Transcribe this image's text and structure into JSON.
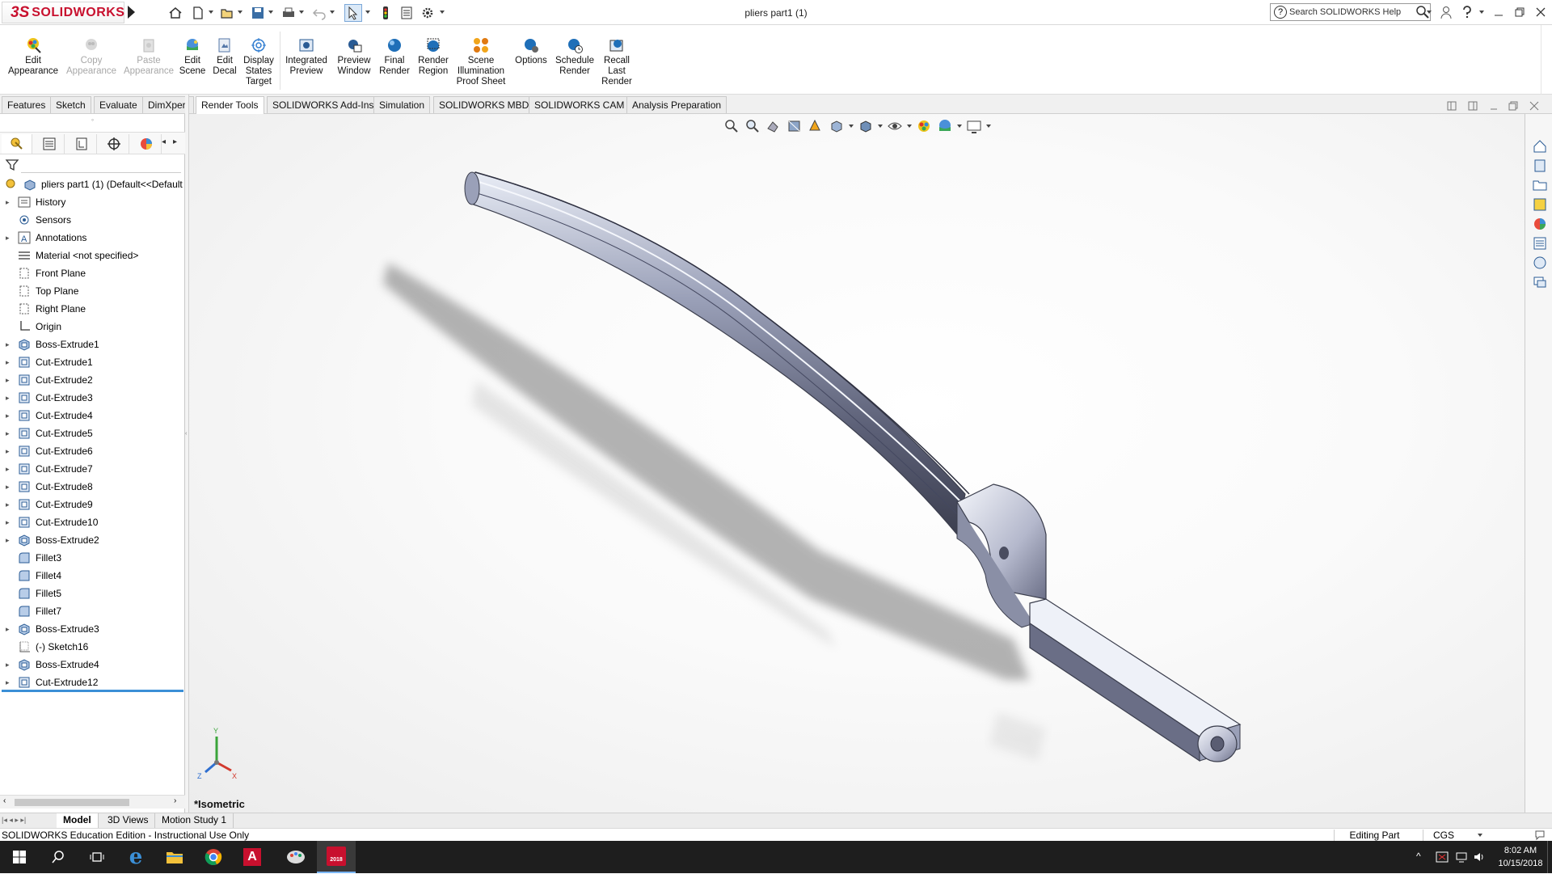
{
  "app": {
    "brand_ds": "3S",
    "brand_name": "SOLIDWORKS",
    "document_title": "pliers part1 (1)",
    "search_placeholder": "Search SOLIDWORKS Help",
    "search_q": "?",
    "brand_color": "#c8102e"
  },
  "command_manager": [
    {
      "label": "Edit Appearance",
      "icon": "edit-appearance-icon",
      "enabled": true
    },
    {
      "label": "Copy Appearance",
      "icon": "copy-appearance-icon",
      "enabled": false
    },
    {
      "label": "Paste Appearance",
      "icon": "paste-appearance-icon",
      "enabled": false
    },
    {
      "label": "Edit Scene",
      "icon": "edit-scene-icon",
      "enabled": true
    },
    {
      "label": "Edit Decal",
      "icon": "edit-decal-icon",
      "enabled": true
    },
    {
      "label": "Display States Target",
      "icon": "display-states-target-icon",
      "enabled": true
    },
    {
      "label": "Integrated Preview",
      "icon": "integrated-preview-icon",
      "enabled": true
    },
    {
      "label": "Preview Window",
      "icon": "preview-window-icon",
      "enabled": true
    },
    {
      "label": "Final Render",
      "icon": "final-render-icon",
      "enabled": true
    },
    {
      "label": "Render Region",
      "icon": "render-region-icon",
      "enabled": true
    },
    {
      "label": "Scene Illumination Proof Sheet",
      "icon": "scene-illumination-icon",
      "enabled": true
    },
    {
      "label": "Options",
      "icon": "options-icon",
      "enabled": true
    },
    {
      "label": "Schedule Render",
      "icon": "schedule-render-icon",
      "enabled": true
    },
    {
      "label": "Recall Last Render",
      "icon": "recall-last-render-icon",
      "enabled": true
    }
  ],
  "tabs": [
    "Features",
    "Sketch",
    "Evaluate",
    "DimXpert",
    "Render Tools",
    "SOLIDWORKS Add-Ins",
    "Simulation",
    "SOLIDWORKS MBD",
    "SOLIDWORKS CAM",
    "Analysis Preparation"
  ],
  "active_tab": "Render Tools",
  "tree": {
    "root": "pliers part1 (1)  (Default<<Default",
    "items": [
      {
        "label": "History",
        "expandable": true,
        "icon": "history-icon"
      },
      {
        "label": "Sensors",
        "expandable": false,
        "icon": "sensors-icon"
      },
      {
        "label": "Annotations",
        "expandable": true,
        "icon": "annotations-icon"
      },
      {
        "label": "Material <not specified>",
        "expandable": false,
        "icon": "material-icon"
      },
      {
        "label": "Front Plane",
        "expandable": false,
        "icon": "plane-icon"
      },
      {
        "label": "Top Plane",
        "expandable": false,
        "icon": "plane-icon"
      },
      {
        "label": "Right Plane",
        "expandable": false,
        "icon": "plane-icon"
      },
      {
        "label": "Origin",
        "expandable": false,
        "icon": "origin-icon"
      },
      {
        "label": "Boss-Extrude1",
        "expandable": true,
        "icon": "boss-extrude-icon"
      },
      {
        "label": "Cut-Extrude1",
        "expandable": true,
        "icon": "cut-extrude-icon"
      },
      {
        "label": "Cut-Extrude2",
        "expandable": true,
        "icon": "cut-extrude-icon"
      },
      {
        "label": "Cut-Extrude3",
        "expandable": true,
        "icon": "cut-extrude-icon"
      },
      {
        "label": "Cut-Extrude4",
        "expandable": true,
        "icon": "cut-extrude-icon"
      },
      {
        "label": "Cut-Extrude5",
        "expandable": true,
        "icon": "cut-extrude-icon"
      },
      {
        "label": "Cut-Extrude6",
        "expandable": true,
        "icon": "cut-extrude-icon"
      },
      {
        "label": "Cut-Extrude7",
        "expandable": true,
        "icon": "cut-extrude-icon"
      },
      {
        "label": "Cut-Extrude8",
        "expandable": true,
        "icon": "cut-extrude-icon"
      },
      {
        "label": "Cut-Extrude9",
        "expandable": true,
        "icon": "cut-extrude-icon"
      },
      {
        "label": "Cut-Extrude10",
        "expandable": true,
        "icon": "cut-extrude-icon"
      },
      {
        "label": "Boss-Extrude2",
        "expandable": true,
        "icon": "boss-extrude-icon"
      },
      {
        "label": "Fillet3",
        "expandable": false,
        "icon": "fillet-icon"
      },
      {
        "label": "Fillet4",
        "expandable": false,
        "icon": "fillet-icon"
      },
      {
        "label": "Fillet5",
        "expandable": false,
        "icon": "fillet-icon"
      },
      {
        "label": "Fillet7",
        "expandable": false,
        "icon": "fillet-icon"
      },
      {
        "label": "Boss-Extrude3",
        "expandable": true,
        "icon": "boss-extrude-icon"
      },
      {
        "label": "(-) Sketch16",
        "expandable": false,
        "icon": "sketch-icon"
      },
      {
        "label": "Boss-Extrude4",
        "expandable": true,
        "icon": "boss-extrude-icon"
      },
      {
        "label": "Cut-Extrude12",
        "expandable": true,
        "icon": "cut-extrude-icon"
      }
    ]
  },
  "viewport": {
    "view_label": "*Isometric",
    "triad": {
      "x": "X",
      "y": "Y",
      "z": "Z"
    }
  },
  "bottom_tabs": [
    "Model",
    "3D Views",
    "Motion Study 1"
  ],
  "active_bottom_tab": "Model",
  "status": {
    "left": "SOLIDWORKS Education Edition - Instructional Use Only",
    "mode": "Editing Part",
    "units": "CGS"
  },
  "taskbar": {
    "time": "8:02 AM",
    "date": "10/15/2018",
    "sw_badge": "2018",
    "autocad_letter": "A",
    "edge_letter": "e"
  }
}
